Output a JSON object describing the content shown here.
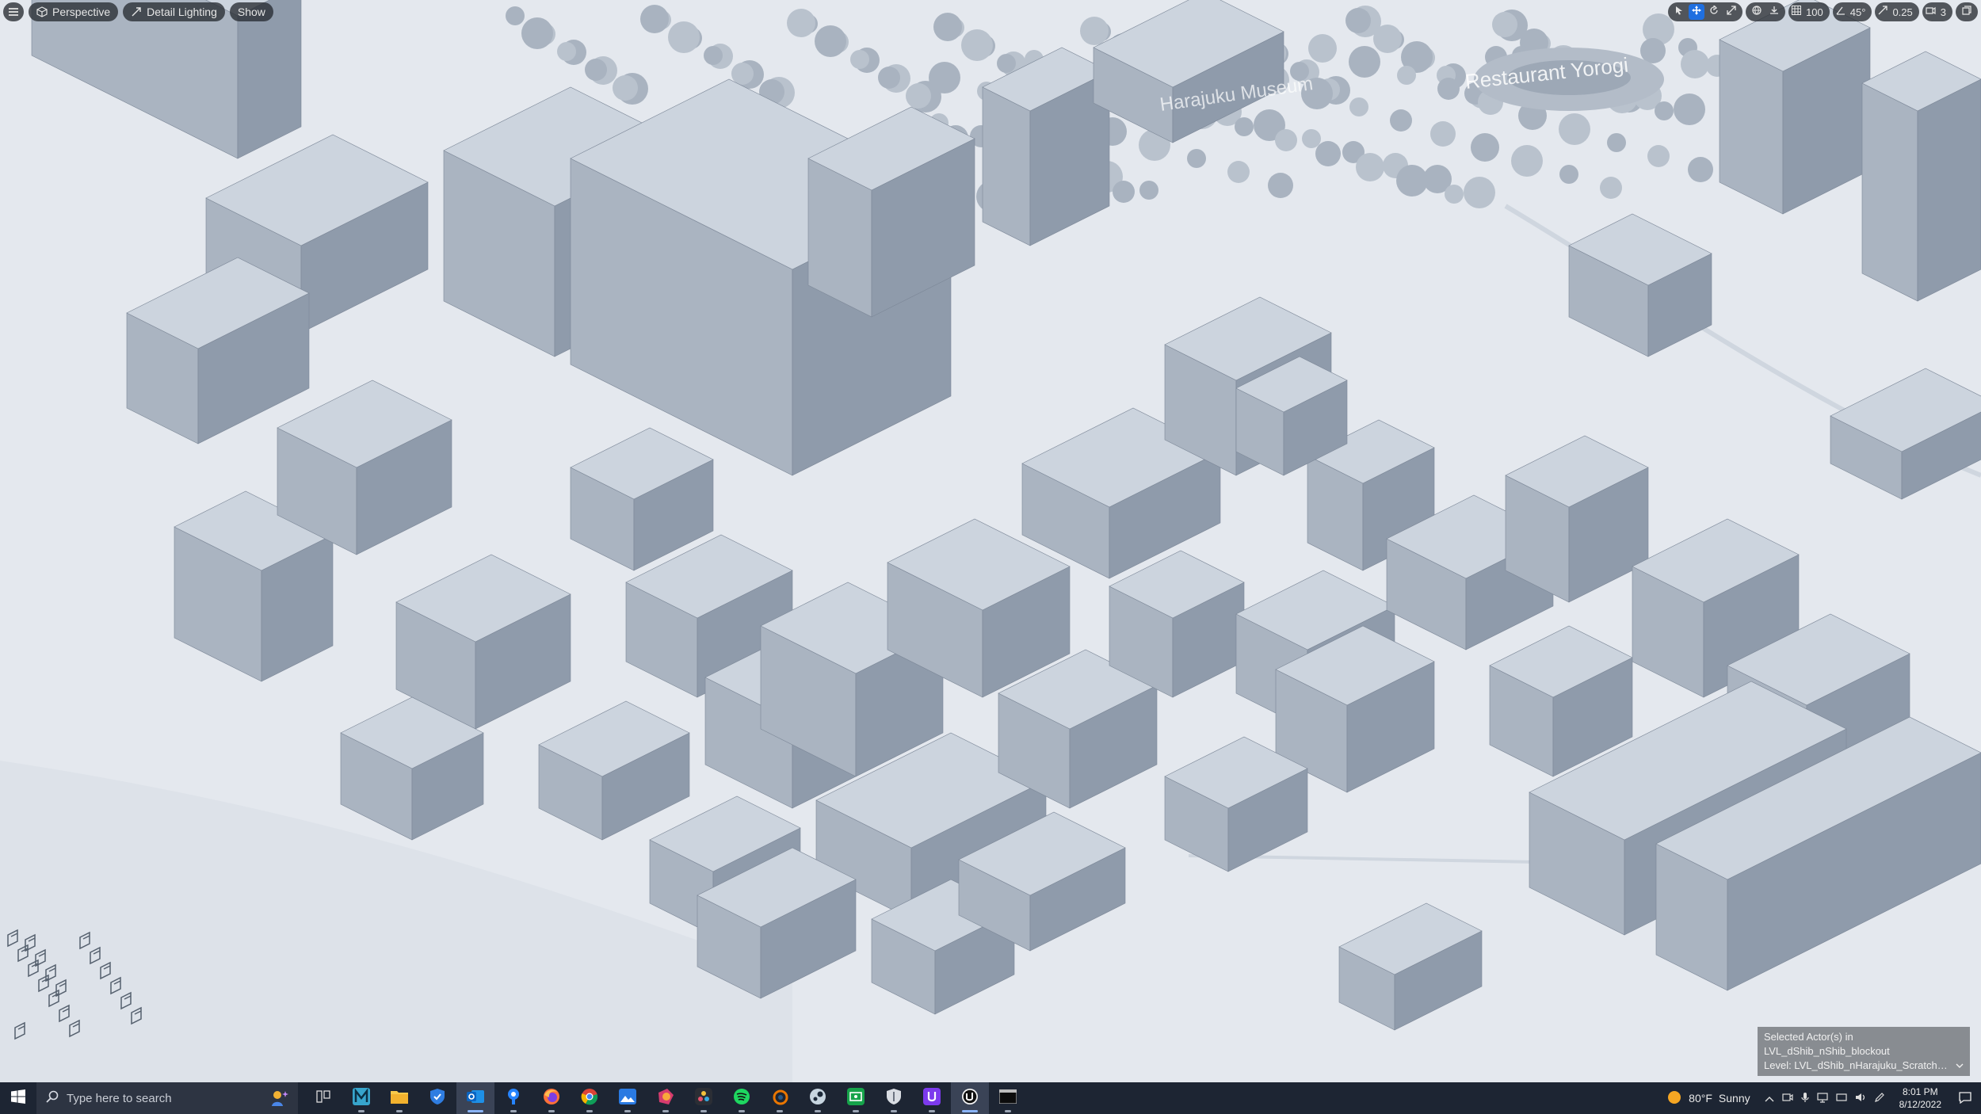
{
  "viewport": {
    "menu_icon": "hamburger-icon",
    "view_mode": "Perspective",
    "lighting_mode": "Detail Lighting",
    "show_label": "Show",
    "grid_snap_value": "100",
    "rotation_snap_value": "45°",
    "scale_snap_value": "0.25",
    "camera_speed_value": "3"
  },
  "scene": {
    "sign_museum": "Harajuku Museum",
    "sign_restaurant": "Restaurant Yorogi"
  },
  "selected_actor": {
    "line1": "Selected Actor(s) in",
    "line2": "LVL_dShib_nShib_blockout",
    "line3": "Level: LVL_dShib_nHarajuku_ScratchMap"
  },
  "taskbar": {
    "search_placeholder": "Type here to search",
    "apps": [
      "task-view",
      "maya",
      "file-explorer",
      "shield-app",
      "outlook",
      "sourcetree",
      "firefox",
      "chrome",
      "photos",
      "rider",
      "davinci-resolve",
      "spotify",
      "blender",
      "steam",
      "cash-app",
      "vpn",
      "epic-games",
      "unreal-engine",
      "terminal"
    ],
    "weather_temp": "80°F",
    "weather_text": "Sunny",
    "time": "8:01 PM",
    "date": "8/12/2022"
  },
  "colors": {
    "ground": "#e4e8ee",
    "building_top": "#ccd4de",
    "building_left": "#aab4c1",
    "building_right": "#8f9bab",
    "taskbar": "#1d2533",
    "accent": "#1f6fe0"
  }
}
